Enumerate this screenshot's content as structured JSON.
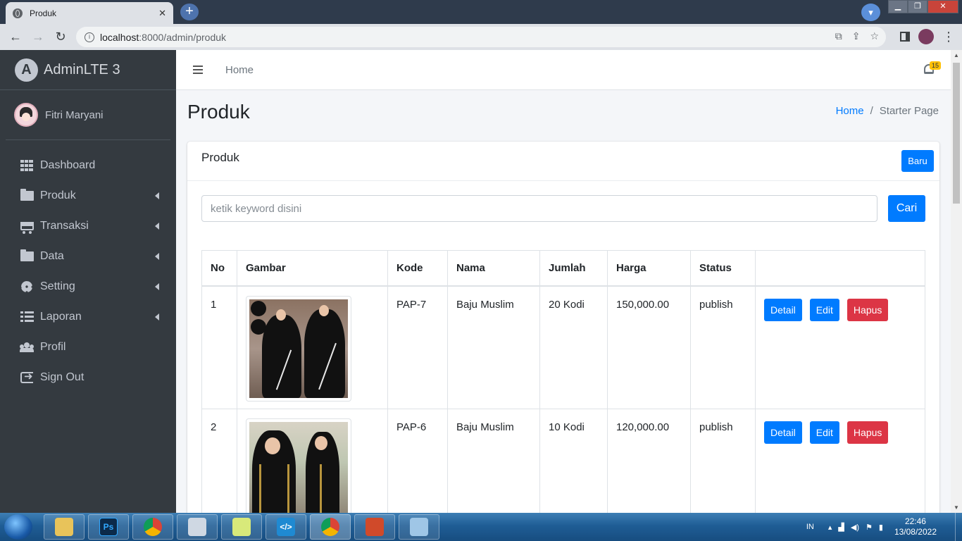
{
  "browser": {
    "tab_title": "Produk",
    "tab_close": "✕",
    "new_tab": "+",
    "url_host": "localhost",
    "url_path": ":8000/admin/produk",
    "win_minimize": "▁",
    "win_maximize": "❐",
    "win_close": "✕"
  },
  "sidebar": {
    "brand": "AdminLTE 3",
    "user_name": "Fitri Maryani",
    "items": [
      {
        "label": "Dashboard",
        "icon": "grid-icon",
        "has_caret": false
      },
      {
        "label": "Produk",
        "icon": "folder-open-icon",
        "has_caret": true
      },
      {
        "label": "Transaksi",
        "icon": "cart-icon",
        "has_caret": true
      },
      {
        "label": "Data",
        "icon": "folder-icon",
        "has_caret": true
      },
      {
        "label": "Setting",
        "icon": "gears-icon",
        "has_caret": true
      },
      {
        "label": "Laporan",
        "icon": "list-icon",
        "has_caret": true
      },
      {
        "label": "Profil",
        "icon": "users-icon",
        "has_caret": false
      },
      {
        "label": "Sign Out",
        "icon": "sign-out-icon",
        "has_caret": false
      }
    ]
  },
  "topnav": {
    "home_link": "Home",
    "notification_count": "15"
  },
  "content": {
    "page_title": "Produk",
    "breadcrumb": {
      "home": "Home",
      "separator": "/",
      "current": "Starter Page"
    },
    "card_title": "Produk",
    "new_button": "Baru",
    "search_placeholder": "ketik keyword disini",
    "search_button": "Cari"
  },
  "table": {
    "headers": [
      "No",
      "Gambar",
      "Kode",
      "Nama",
      "Jumlah",
      "Harga",
      "Status",
      ""
    ],
    "rows": [
      {
        "no": "1",
        "kode": "PAP-7",
        "nama": "Baju Muslim",
        "jumlah": "20 Kodi",
        "harga": "150,000.00",
        "status": "publish"
      },
      {
        "no": "2",
        "kode": "PAP-6",
        "nama": "Baju Muslim",
        "jumlah": "10 Kodi",
        "harga": "120,000.00",
        "status": "publish"
      }
    ],
    "actions": {
      "detail": "Detail",
      "edit": "Edit",
      "delete": "Hapus"
    }
  },
  "taskbar": {
    "apps": [
      "Explorer",
      "Photoshop",
      "Chrome",
      "Keyboard",
      "Notes",
      "VS Code",
      "Chrome",
      "Presenter",
      "Paint"
    ],
    "photoshop_label": "Ps",
    "language": "IN",
    "time": "22:46",
    "date": "13/08/2022"
  },
  "colors": {
    "sidebar_bg": "#343a40",
    "primary": "#007bff",
    "danger": "#dc3545",
    "badge": "#ffc107"
  }
}
